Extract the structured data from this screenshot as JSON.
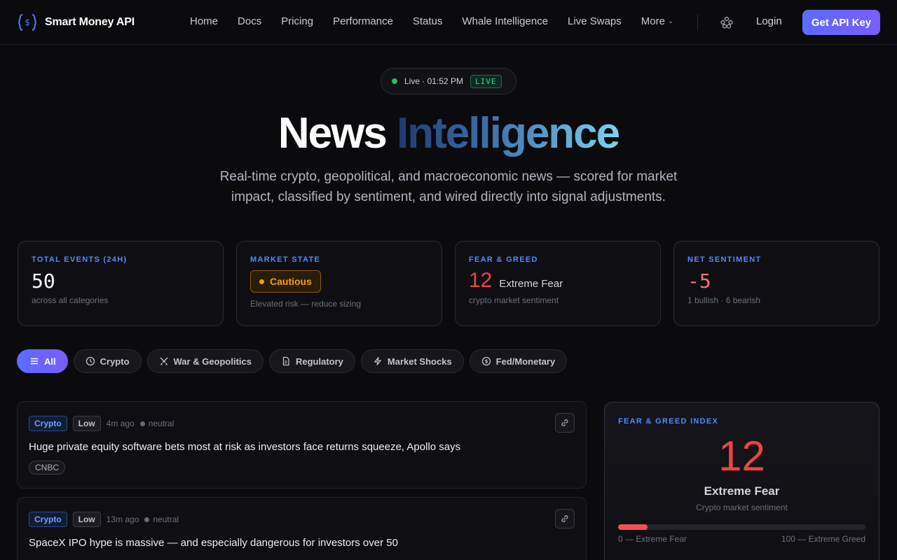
{
  "nav": {
    "brand": "Smart Money API",
    "links": [
      "Home",
      "Docs",
      "Pricing",
      "Performance",
      "Status",
      "Whale Intelligence",
      "Live Swaps"
    ],
    "more": "More",
    "login": "Login",
    "cta": "Get API Key"
  },
  "hero": {
    "live_text": "Live · 01:52 PM",
    "live_tag": "LIVE",
    "title_plain": "News",
    "title_accent": "Intelligence",
    "subtitle": "Real-time crypto, geopolitical, and macroeconomic news — scored for market impact, classified by sentiment, and wired directly into signal adjustments."
  },
  "stats": {
    "total": {
      "label": "TOTAL EVENTS (24H)",
      "value": "50",
      "sub": "across all categories"
    },
    "market": {
      "label": "MARKET STATE",
      "value": "Cautious",
      "sub": "Elevated risk — reduce sizing"
    },
    "fear": {
      "label": "FEAR & GREED",
      "value": "12",
      "value_text": "Extreme Fear",
      "sub": "crypto market sentiment"
    },
    "net": {
      "label": "NET SENTIMENT",
      "value": "-5",
      "sub": "1 bullish · 6 bearish"
    }
  },
  "filters": [
    "All",
    "Crypto",
    "War & Geopolitics",
    "Regulatory",
    "Market Shocks",
    "Fed/Monetary"
  ],
  "news": [
    {
      "category": "Crypto",
      "impact": "Low",
      "time": "4m ago",
      "sentiment": "neutral",
      "title": "Huge private equity software bets most at risk as investors face returns squeeze, Apollo says",
      "source": "CNBC"
    },
    {
      "category": "Crypto",
      "impact": "Low",
      "time": "13m ago",
      "sentiment": "neutral",
      "title": "SpaceX IPO hype is massive — and especially dangerous for investors over 50",
      "source": ""
    }
  ],
  "fear_greed": {
    "label": "FEAR & GREED INDEX",
    "value": "12",
    "level": 0.12,
    "state": "Extreme Fear",
    "desc": "Crypto market sentiment",
    "min_label": "0 — Extreme Fear",
    "max_label": "100 — Extreme Greed",
    "fill_color": "#f05252"
  },
  "colors": {
    "accent": "#4f8cff",
    "bearish": "#ef4444",
    "warning": "#f59e0b",
    "live": "#22c55e"
  }
}
